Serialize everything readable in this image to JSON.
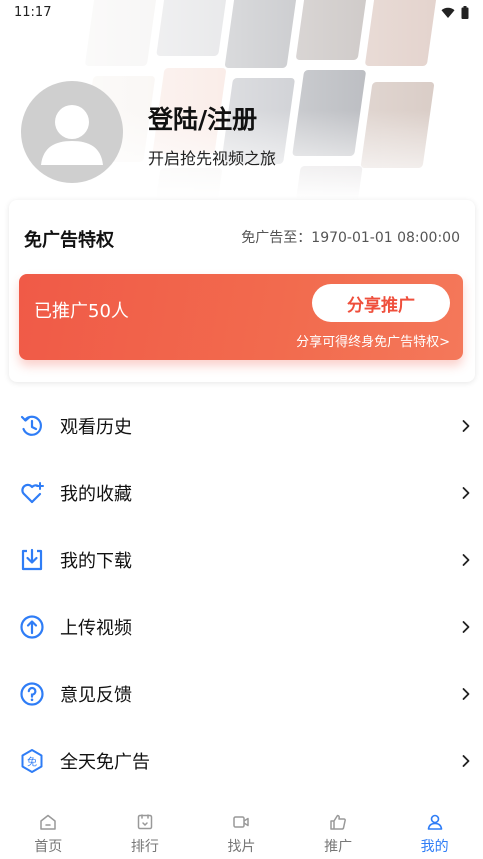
{
  "status_bar": {
    "time": "11:17"
  },
  "profile": {
    "title": "登陆/注册",
    "subtitle": "开启抢先视频之旅"
  },
  "privilege": {
    "title": "免广告特权",
    "expire_text": "免广告至：1970-01-01 08:00:00",
    "promo_count": "已推广50人",
    "share_button": "分享推广",
    "share_tip": "分享可得终身免广告特权>"
  },
  "menu": {
    "items": [
      {
        "label": "观看历史",
        "icon": "history-icon"
      },
      {
        "label": "我的收藏",
        "icon": "heart-icon"
      },
      {
        "label": "我的下载",
        "icon": "download-icon"
      },
      {
        "label": "上传视频",
        "icon": "upload-icon"
      },
      {
        "label": "意见反馈",
        "icon": "question-icon"
      },
      {
        "label": "全天免广告",
        "icon": "no-ads-icon"
      }
    ]
  },
  "bottom_nav": {
    "items": [
      {
        "label": "首页",
        "icon": "home-icon"
      },
      {
        "label": "排行",
        "icon": "ranking-icon"
      },
      {
        "label": "找片",
        "icon": "video-camera-icon"
      },
      {
        "label": "推广",
        "icon": "thumbs-up-icon"
      },
      {
        "label": "我的",
        "icon": "person-icon"
      }
    ],
    "active_index": 4
  },
  "colors": {
    "accent_blue": "#2f7df6",
    "promo_red": "#f05a47",
    "avatar_grey": "#cfcfcf"
  }
}
